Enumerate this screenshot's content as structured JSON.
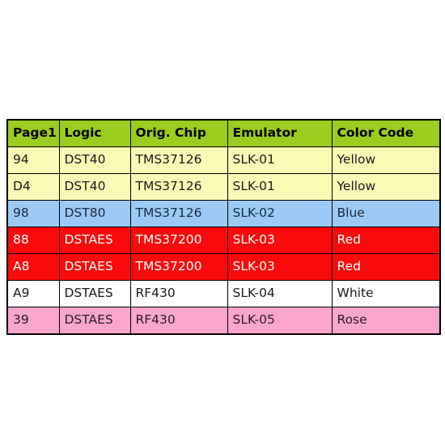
{
  "table": {
    "name": "chip-emulator-color-code-table",
    "columns": [
      "Page1",
      "Logic",
      "Orig. Chip",
      "Emulator",
      "Color Code"
    ],
    "header_bg": "#9ACD1E",
    "header_text_color": "#000000",
    "border_color": "#000000",
    "rows": [
      {
        "page1": "94",
        "logic": "DST40",
        "orig_chip": "TMS37126",
        "emulator": "SLK-01",
        "color_code": "Yellow",
        "row_style": "row-yellow",
        "bg": "#FAFAB4",
        "fg": "#1a1a1a"
      },
      {
        "page1": "D4",
        "logic": "DST40",
        "orig_chip": "TMS37126",
        "emulator": "SLK-01",
        "color_code": "Yellow",
        "row_style": "row-yellow",
        "bg": "#FAFAB4",
        "fg": "#1a1a1a"
      },
      {
        "page1": "98",
        "logic": "DST80",
        "orig_chip": "TMS37126",
        "emulator": "SLK-02",
        "color_code": "Blue",
        "row_style": "row-blue",
        "bg": "#9BCAF5",
        "fg": "#1a2a3a"
      },
      {
        "page1": "88",
        "logic": "DSTAES",
        "orig_chip": "TMS37200",
        "emulator": "SLK-03",
        "color_code": "Red",
        "row_style": "row-red",
        "bg": "#FA0A0A",
        "fg": "#ffffff"
      },
      {
        "page1": "A8",
        "logic": "DSTAES",
        "orig_chip": "TMS37200",
        "emulator": "SLK-03",
        "color_code": "Red",
        "row_style": "row-red",
        "bg": "#FA0A0A",
        "fg": "#ffffff"
      },
      {
        "page1": "A9",
        "logic": "DSTAES",
        "orig_chip": "RF430",
        "emulator": "SLK-04",
        "color_code": "White",
        "row_style": "row-white",
        "bg": "#FFFFFF",
        "fg": "#1a1a1a"
      },
      {
        "page1": "39",
        "logic": "DSTAES",
        "orig_chip": "RF430",
        "emulator": "SLK-05",
        "color_code": "Rose",
        "row_style": "row-rose",
        "bg": "#FAA6CC",
        "fg": "#2a1a22"
      }
    ]
  }
}
